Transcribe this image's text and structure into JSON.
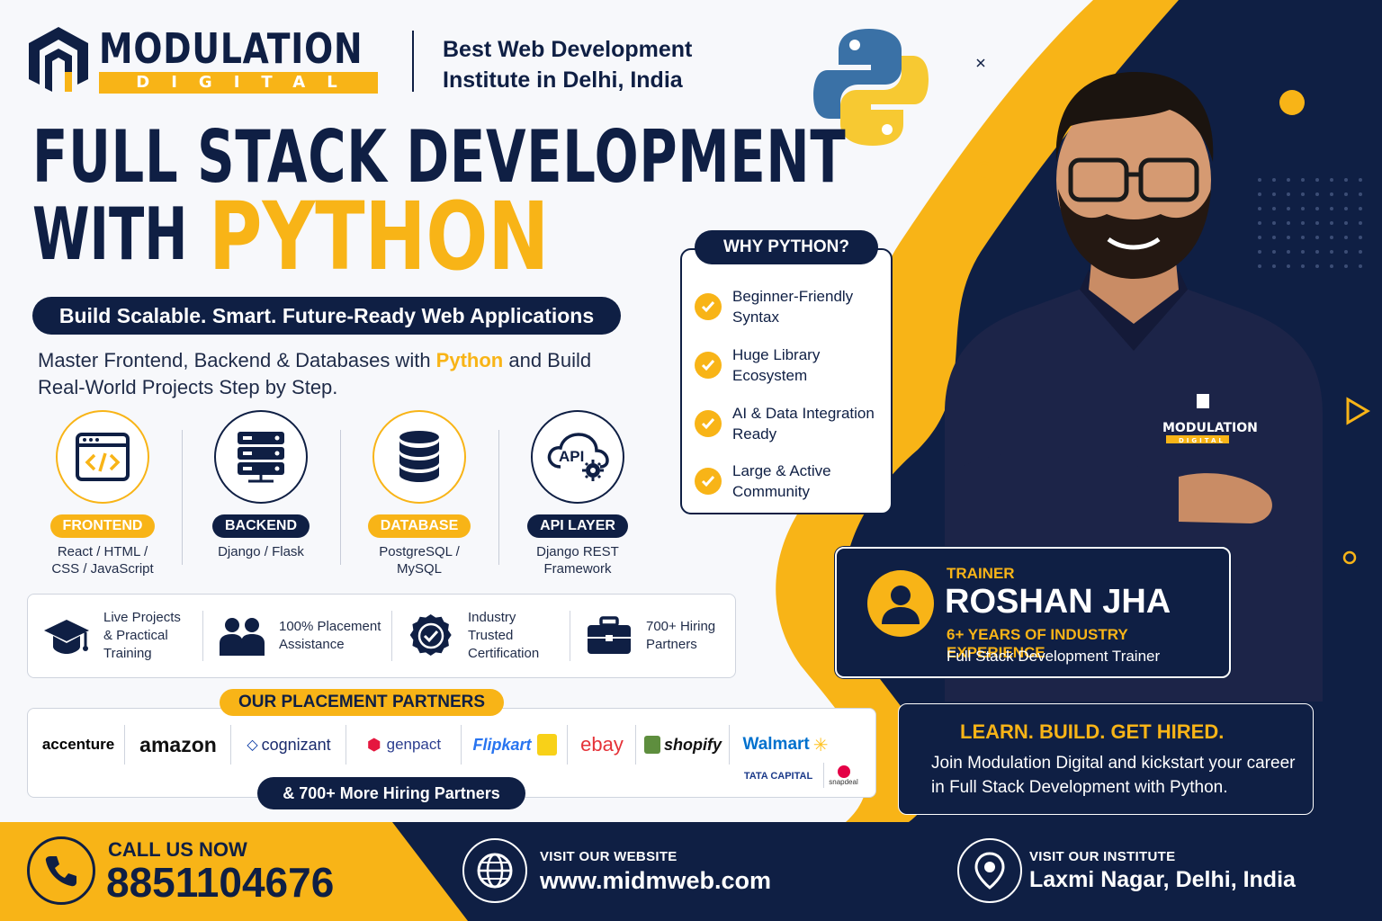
{
  "brand": {
    "name": "MODULATION",
    "sub": "DIGITAL",
    "tagline": "Best Web Development Institute in Delhi, India"
  },
  "headline": {
    "line1": "FULL STACK DEVELOPMENT",
    "line2_prefix": "WITH",
    "line2_highlight": "PYTHON"
  },
  "subtitle": "Build Scalable. Smart. Future-Ready Web Applications",
  "description": {
    "part1": "Master Frontend, Backend & Databases with ",
    "highlight": "Python",
    "part2": " and Build Real-World Projects Step by Step."
  },
  "stack": [
    {
      "label": "FRONTEND",
      "tech": "React / HTML / CSS / JavaScript",
      "icon": "code-window-icon"
    },
    {
      "label": "BACKEND",
      "tech": "Django / Flask",
      "icon": "server-icon"
    },
    {
      "label": "DATABASE",
      "tech": "PostgreSQL / MySQL",
      "icon": "database-icon"
    },
    {
      "label": "API LAYER",
      "tech": "Django REST Framework",
      "icon": "api-cloud-icon"
    }
  ],
  "features": [
    {
      "label": "Live Projects & Practical Training",
      "icon": "graduation-cap-icon"
    },
    {
      "label": "100% Placement Assistance",
      "icon": "people-icon"
    },
    {
      "label": "Industry Trusted Certification",
      "icon": "certificate-badge-icon"
    },
    {
      "label": "700+ Hiring Partners",
      "icon": "briefcase-icon"
    }
  ],
  "placement": {
    "title": "OUR PLACEMENT PARTNERS",
    "partners": [
      "accenture",
      "amazon",
      "cognizant",
      "genpact",
      "Flipkart",
      "ebay",
      "shopify",
      "Walmart",
      "TATA CAPITAL",
      "snapdeal"
    ],
    "more": "& 700+ More Hiring Partners"
  },
  "why": {
    "title": "WHY PYTHON?",
    "items": [
      "Beginner-Friendly Syntax",
      "Huge Library Ecosystem",
      "AI & Data Integration Ready",
      "Large & Active Community"
    ]
  },
  "shirt_logo": {
    "name": "MODULATION",
    "sub": "DIGITAL"
  },
  "trainer": {
    "role": "TRAINER",
    "name": "ROSHAN JHA",
    "experience": "6+ YEARS OF INDUSTRY EXPERIENCE",
    "title": "Full Stack Development Trainer"
  },
  "cta": {
    "title": "LEARN. BUILD. GET HIRED.",
    "text": "Join Modulation Digital and kickstart your career in Full Stack Development with Python."
  },
  "footer": {
    "call_label": "CALL US NOW",
    "phone": "8851104676",
    "website_label": "VISIT OUR WEBSITE",
    "website": "www.midmweb.com",
    "institute_label": "VISIT OUR INSTITUTE",
    "address": "Laxmi Nagar, Delhi, India"
  },
  "colors": {
    "navy": "#0f1f44",
    "yellow": "#f8b417",
    "python_blue": "#3a71a6",
    "python_yellow": "#f7c932"
  }
}
